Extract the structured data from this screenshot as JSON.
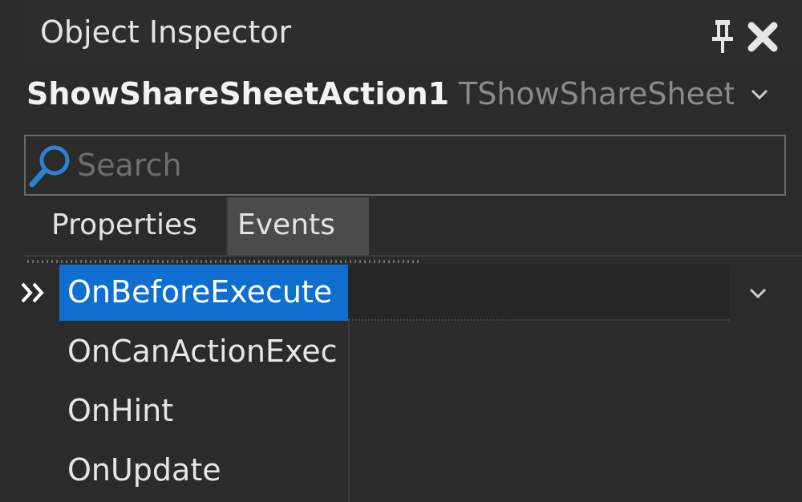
{
  "panel": {
    "title": "Object Inspector",
    "pin_icon": "pin-icon",
    "close_icon": "close-icon"
  },
  "object_selector": {
    "name": "ShowShareSheetAction1",
    "type": "TShowShareSheet",
    "dropdown_icon": "chevron-down-icon"
  },
  "search": {
    "placeholder": "Search",
    "value": "",
    "icon": "search-icon"
  },
  "tabs": [
    {
      "label": "Properties",
      "active": false
    },
    {
      "label": "Events",
      "active": true
    }
  ],
  "events": {
    "rows": [
      {
        "name": "OnBeforeExecute",
        "value": "",
        "selected": true
      },
      {
        "name": "OnCanActionExec",
        "value": "",
        "selected": false
      },
      {
        "name": "OnHint",
        "value": "",
        "selected": false
      },
      {
        "name": "OnUpdate",
        "value": "",
        "selected": false
      }
    ],
    "current_marker_icon": "double-chevron-right-icon",
    "value_dropdown_icon": "chevron-down-icon"
  },
  "colors": {
    "selection": "#0e6fd1",
    "background": "#2b2b2b",
    "text": "#e6e6e6",
    "muted_text": "#8a8a8a"
  }
}
